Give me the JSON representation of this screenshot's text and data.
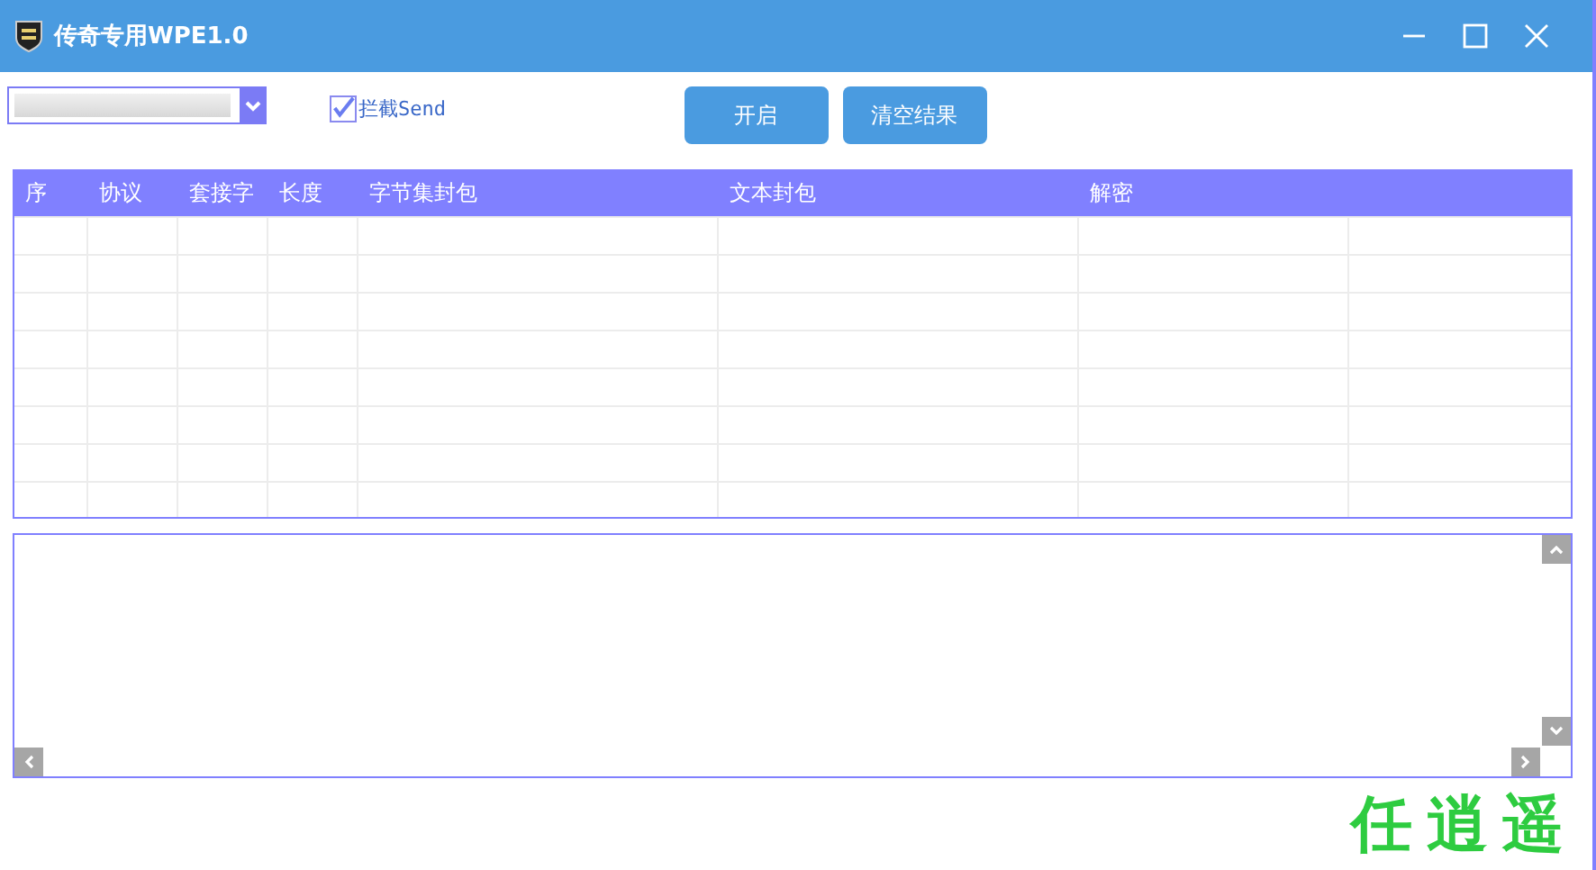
{
  "window": {
    "title": "传奇专用WPE1.0"
  },
  "toolbar": {
    "intercept": {
      "label": "拦截Send",
      "checked": true
    },
    "buttons": [
      "开启",
      "清空结果"
    ]
  },
  "table": {
    "columns": [
      "序",
      "协议",
      "套接字",
      "长度",
      "字节集封包",
      "文本封包",
      "解密"
    ]
  },
  "footer": {
    "brand": "任逍遥"
  }
}
